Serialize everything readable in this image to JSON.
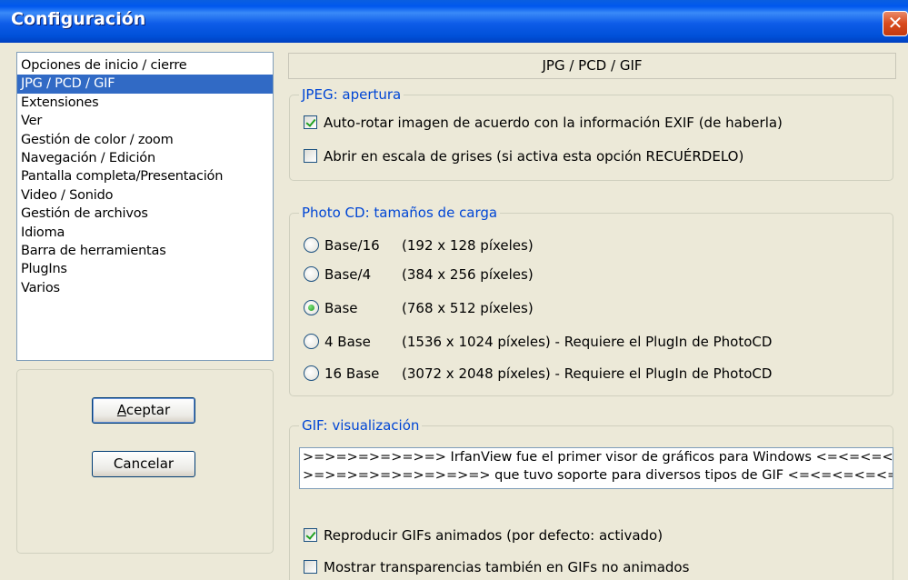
{
  "window": {
    "title": "Configuración",
    "close_icon": "close-icon",
    "close_glyph": "✕"
  },
  "categories": {
    "items": [
      "Opciones de inicio / cierre",
      "JPG / PCD / GIF",
      "Extensiones",
      "Ver",
      "Gestión de color / zoom",
      "Navegación / Edición",
      "Pantalla completa/Presentación",
      "Video / Sonido",
      "Gestión de archivos",
      "Idioma",
      "Barra de herramientas",
      "PlugIns",
      "Varios"
    ],
    "selected_index": 1
  },
  "buttons": {
    "accept": {
      "hotkey": "A",
      "rest": "ceptar"
    },
    "cancel": {
      "label": "Cancelar"
    }
  },
  "panel": {
    "header": "JPG / PCD / GIF"
  },
  "jpeg": {
    "legend": "JPEG: apertura",
    "options": [
      {
        "label": "Auto-rotar imagen de acuerdo con la información EXIF (de haberla)",
        "checked": true
      },
      {
        "label": "Abrir en escala de grises (si activa esta opción RECUÉRDELO)",
        "checked": false
      }
    ]
  },
  "photocd": {
    "legend": "Photo CD: tamaños de carga",
    "options": [
      {
        "name": "Base/16",
        "desc": "(192 x 128 píxeles)",
        "selected": false
      },
      {
        "name": "Base/4",
        "desc": "(384 x 256 píxeles)",
        "selected": false
      },
      {
        "name": "Base",
        "desc": "(768 x 512 píxeles)",
        "selected": true
      },
      {
        "name": "4 Base",
        "desc": "(1536 x 1024 píxeles) - Requiere el PlugIn de PhotoCD",
        "selected": false
      },
      {
        "name": "16 Base",
        "desc": "(3072 x 2048 píxeles) - Requiere el PlugIn de PhotoCD",
        "selected": false
      }
    ]
  },
  "gif": {
    "legend": "GIF: visualización",
    "text_lines": [
      ">=>=>=>=>=>=> IrfanView fue el primer visor de gráficos para Windows <=<=<=<=<=<=<",
      ">=>=>=>=>=>=>=>=> que tuvo soporte para diversos tipos de GIF <=<=<=<=<=<=<=<=<"
    ],
    "options": [
      {
        "label": "Reproducir GIFs animados (por defecto: activado)",
        "checked": true
      },
      {
        "label": "Mostrar transparencias también en GIFs no animados",
        "checked": false
      }
    ]
  }
}
